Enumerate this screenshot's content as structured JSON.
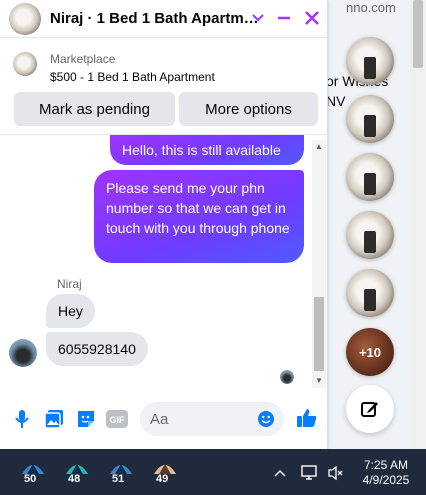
{
  "background": {
    "fragment_1": "nno.com",
    "fragment_2": "or Wishes",
    "fragment_3": "NV",
    "more_heads_label": "+10"
  },
  "chat": {
    "title": "Niraj · 1 Bed 1 Bath Apartm…",
    "listing_source": "Marketplace",
    "listing_title": "$500 - 1 Bed 1 Bath Apartment",
    "mark_pending_label": "Mark as pending",
    "more_options_label": "More options",
    "messages": [
      {
        "from": "me",
        "text": "Hello, this is still available"
      },
      {
        "from": "me",
        "text": "Please send me your phn number so that we can get in touch with you through phone"
      },
      {
        "from": "Niraj",
        "text": "Hey"
      },
      {
        "from": "Niraj",
        "text": "6055928140"
      }
    ],
    "sender_name": "Niraj",
    "input_placeholder": "Aa"
  },
  "taskbar": {
    "apps": [
      {
        "icon": "weather-icon",
        "badge": "50"
      },
      {
        "icon": "weather-icon",
        "badge": "48"
      },
      {
        "icon": "weather-icon",
        "badge": "51"
      },
      {
        "icon": "weather-icon",
        "badge": "49"
      }
    ],
    "time": "7:25 AM",
    "date": "4/9/2025"
  },
  "colors": {
    "accent": "#a033ff",
    "messenger_blue": "#0a7cff",
    "taskbar": "#1f2a3c"
  }
}
